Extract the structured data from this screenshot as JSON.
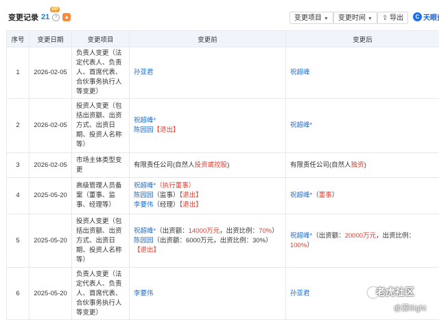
{
  "header": {
    "title": "变更记录",
    "count": "21",
    "vip_badge": "VIP",
    "filter_item_label": "变更项目",
    "filter_time_label": "变更时间",
    "export_label": "导出",
    "logo_text": "天眼查",
    "logo_icon_char": "C"
  },
  "table": {
    "headers": [
      "序号",
      "变更日期",
      "变更项目",
      "变更前",
      "变更后"
    ],
    "rows": [
      {
        "no": "1",
        "date": "2026-02-05",
        "item": "负责人变更（法定代表人、负责人、首席代表、合伙事务执行人等变更）",
        "before": [
          [
            {
              "t": "孙亚君",
              "c": "lk"
            }
          ]
        ],
        "after": [
          [
            {
              "t": "祝超峰",
              "c": "lk"
            }
          ]
        ]
      },
      {
        "no": "2",
        "date": "2026-02-05",
        "item": "投资人变更（包括出资额、出资方式、出资日期、投资人名称等）",
        "before": [
          [
            {
              "t": "祝超峰*",
              "c": "lk"
            }
          ],
          [
            {
              "t": "陈园园",
              "c": "lk"
            },
            {
              "t": "【退出】",
              "c": "red"
            }
          ]
        ],
        "after": [
          [
            {
              "t": "祝超峰*",
              "c": "lk"
            }
          ]
        ]
      },
      {
        "no": "3",
        "date": "2026-02-05",
        "item": "市场主体类型变更",
        "before": [
          [
            {
              "t": "有限责任公司(自然人",
              "c": "blk"
            },
            {
              "t": "投资或控股",
              "c": "red"
            },
            {
              "t": ")",
              "c": "blk"
            }
          ]
        ],
        "after": [
          [
            {
              "t": "有限责任公司(自然人",
              "c": "blk"
            },
            {
              "t": "独资",
              "c": "red"
            },
            {
              "t": ")",
              "c": "blk"
            }
          ]
        ]
      },
      {
        "no": "4",
        "date": "2025-05-20",
        "item": "高级管理人员备案（董事、监事、经理等）",
        "before": [
          [
            {
              "t": "祝超峰*",
              "c": "lk"
            },
            {
              "t": "（执行董事）",
              "c": "red"
            }
          ],
          [
            {
              "t": "陈园园",
              "c": "lk"
            },
            {
              "t": "（监事）",
              "c": "blk"
            },
            {
              "t": "【退出】",
              "c": "red"
            }
          ],
          [
            {
              "t": "李要伟",
              "c": "lk"
            },
            {
              "t": "（经理）",
              "c": "blk"
            },
            {
              "t": "【退出】",
              "c": "red"
            }
          ]
        ],
        "after": [
          [
            {
              "t": "祝超峰*",
              "c": "lk"
            },
            {
              "t": "（",
              "c": "blk"
            },
            {
              "t": "董事",
              "c": "red"
            },
            {
              "t": "）",
              "c": "blk"
            }
          ]
        ]
      },
      {
        "no": "5",
        "date": "2025-05-20",
        "item": "投资人变更（包括出资额、出资方式、出资日期、投资人名称等）",
        "before": [
          [
            {
              "t": "祝超峰*",
              "c": "lk"
            },
            {
              "t": "（出资额：",
              "c": "blk"
            },
            {
              "t": "14000万元",
              "c": "red"
            },
            {
              "t": "，出资比例：",
              "c": "blk"
            },
            {
              "t": "70%",
              "c": "red"
            },
            {
              "t": "）",
              "c": "blk"
            }
          ],
          [
            {
              "t": "陈园园",
              "c": "lk"
            },
            {
              "t": "（出资额：6000万元，出资比例：30%）",
              "c": "blk"
            },
            {
              "t": "【退出】",
              "c": "red"
            }
          ]
        ],
        "after": [
          [
            {
              "t": "祝超峰*",
              "c": "lk"
            },
            {
              "t": "（出资额：",
              "c": "blk"
            },
            {
              "t": "20000万元",
              "c": "red"
            },
            {
              "t": "，出资比例：",
              "c": "blk"
            },
            {
              "t": "100%",
              "c": "red"
            },
            {
              "t": "）",
              "c": "blk"
            }
          ]
        ]
      },
      {
        "no": "6",
        "date": "2025-05-20",
        "item": "负责人变更（法定代表人、负责人、首席代表、合伙事务执行人等变更）",
        "before": [
          [
            {
              "t": "李要伟",
              "c": "lk"
            }
          ]
        ],
        "after": [
          [
            {
              "t": "孙亚君",
              "c": "lk"
            }
          ]
        ]
      }
    ]
  },
  "watermark": {
    "text": "老虎社区",
    "sub": "@源Sight"
  }
}
